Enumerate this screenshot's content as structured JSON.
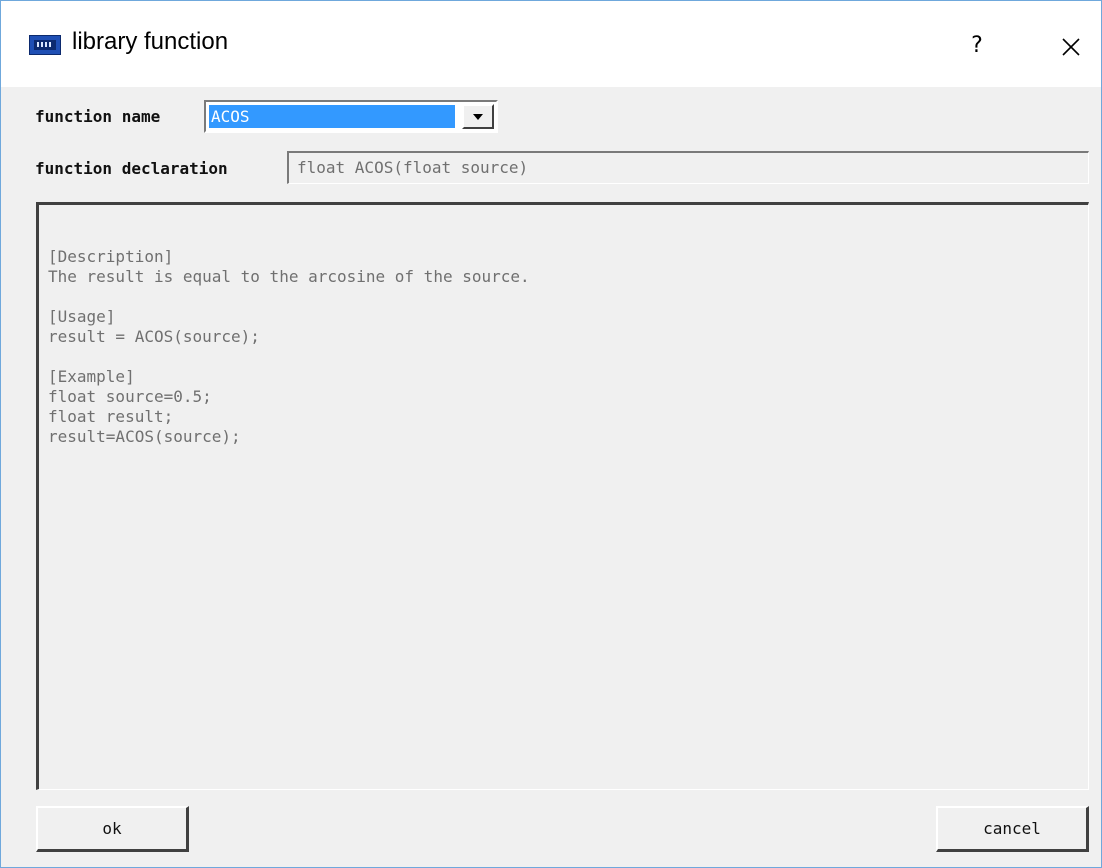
{
  "window": {
    "title": "library function",
    "help_label": "?"
  },
  "form": {
    "function_name_label": "function name",
    "function_name_value": "ACOS",
    "function_declaration_label": "function declaration",
    "function_declaration_value": "float ACOS(float source)"
  },
  "description": {
    "text": "[Description]\nThe result is equal to the arcosine of the source.\n\n[Usage]\nresult = ACOS(source);\n\n[Example]\nfloat source=0.5;\nfloat result;\nresult=ACOS(source);"
  },
  "buttons": {
    "ok_label": "ok",
    "cancel_label": "cancel"
  },
  "icons": {
    "app": "hmi-screen-icon",
    "help": "question-mark-icon",
    "close": "close-icon",
    "dropdown": "dropdown-arrow-icon"
  },
  "colors": {
    "selection": "#3399ff",
    "title_border": "#6fa8dc",
    "dialog_face": "#f0f0f0"
  }
}
